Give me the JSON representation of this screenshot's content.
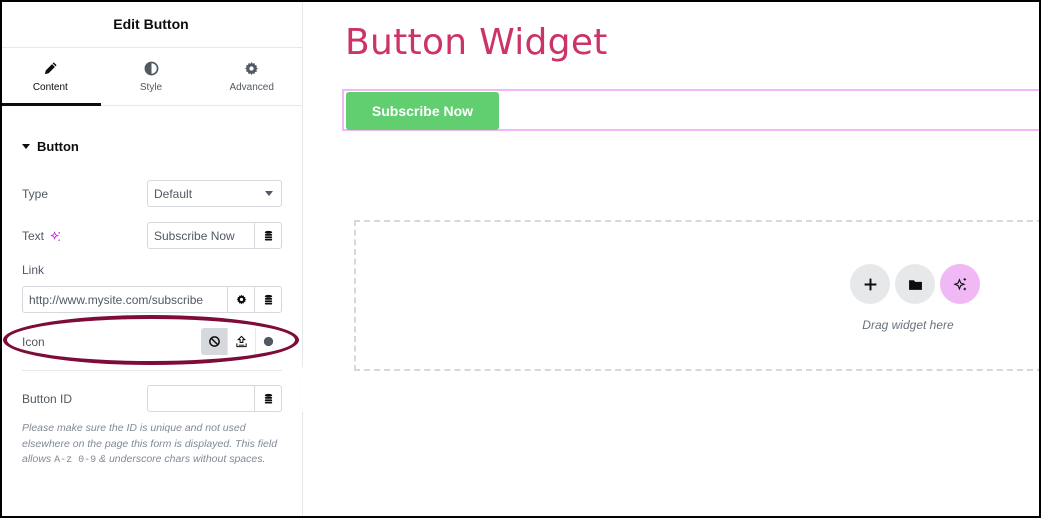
{
  "panel": {
    "title": "Edit Button",
    "tabs": [
      {
        "label": "Content",
        "icon": "pencil-icon",
        "active": true
      },
      {
        "label": "Style",
        "icon": "half-circle-icon",
        "active": false
      },
      {
        "label": "Advanced",
        "icon": "gear-icon",
        "active": false
      }
    ],
    "section_title": "Button",
    "fields": {
      "type": {
        "label": "Type",
        "value": "Default"
      },
      "text": {
        "label": "Text",
        "value": "Subscribe Now"
      },
      "link": {
        "label": "Link",
        "value": "http://www.mysite.com/subscribe"
      },
      "icon": {
        "label": "Icon",
        "options": [
          "none",
          "upload",
          "svg"
        ],
        "selected": "none"
      },
      "button_id": {
        "label": "Button ID",
        "value": "",
        "placeholder": ""
      }
    },
    "help": {
      "part1": "Please make sure the ID is unique and not used elsewhere on the page this form is displayed. This field allows ",
      "code": "A-z 0-9",
      "part2": " & underscore chars without spaces."
    }
  },
  "canvas": {
    "heading": "Button Widget",
    "button_label": "Subscribe Now",
    "dropzone_text": "Drag widget here"
  },
  "colors": {
    "heading": "#cc3366",
    "button": "#61ce70",
    "selection": "#f0b8f5",
    "annotation": "#7d0c3a",
    "ai": "#c036d9"
  }
}
